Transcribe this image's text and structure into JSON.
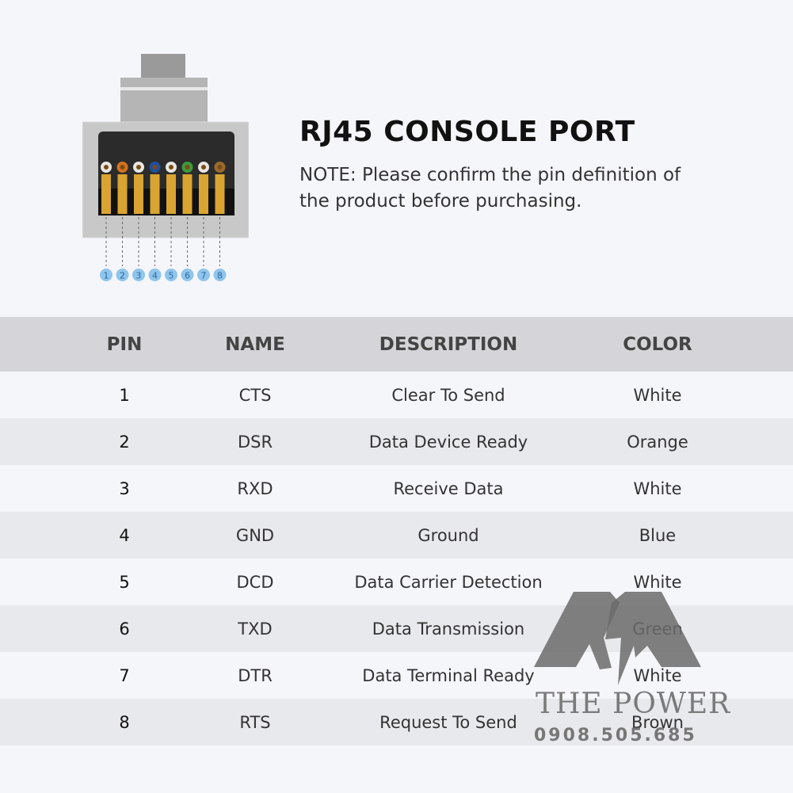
{
  "header": {
    "title": "RJ45 CONSOLE PORT",
    "note": "NOTE: Please confirm the pin definition of the product before purchasing."
  },
  "connector": {
    "pin_numbers": [
      "1",
      "2",
      "3",
      "4",
      "5",
      "6",
      "7",
      "8"
    ],
    "wire_colors": [
      "#e8e6e0",
      "#d5711f",
      "#e8e6e0",
      "#1f4fa0",
      "#e8e6e0",
      "#3f9a3a",
      "#e8e6e0",
      "#9b6a2c"
    ],
    "badge_color": "#8fc4ec"
  },
  "table": {
    "headers": [
      "PIN",
      "NAME",
      "DESCRIPTION",
      "COLOR"
    ],
    "rows": [
      {
        "pin": "1",
        "name": "CTS",
        "description": "Clear To Send",
        "color": "White"
      },
      {
        "pin": "2",
        "name": "DSR",
        "description": "Data Device Ready",
        "color": "Orange"
      },
      {
        "pin": "3",
        "name": "RXD",
        "description": "Receive Data",
        "color": "White"
      },
      {
        "pin": "4",
        "name": "GND",
        "description": "Ground",
        "color": "Blue"
      },
      {
        "pin": "5",
        "name": "DCD",
        "description": "Data Carrier Detection",
        "color": "White"
      },
      {
        "pin": "6",
        "name": "TXD",
        "description": "Data Transmission",
        "color": "Green"
      },
      {
        "pin": "7",
        "name": "DTR",
        "description": "Data Terminal Ready",
        "color": "White"
      },
      {
        "pin": "8",
        "name": "RTS",
        "description": "Request To Send",
        "color": "Brown"
      }
    ]
  },
  "watermark": {
    "brand": "THE POWER",
    "phone": "0908.505.685"
  }
}
